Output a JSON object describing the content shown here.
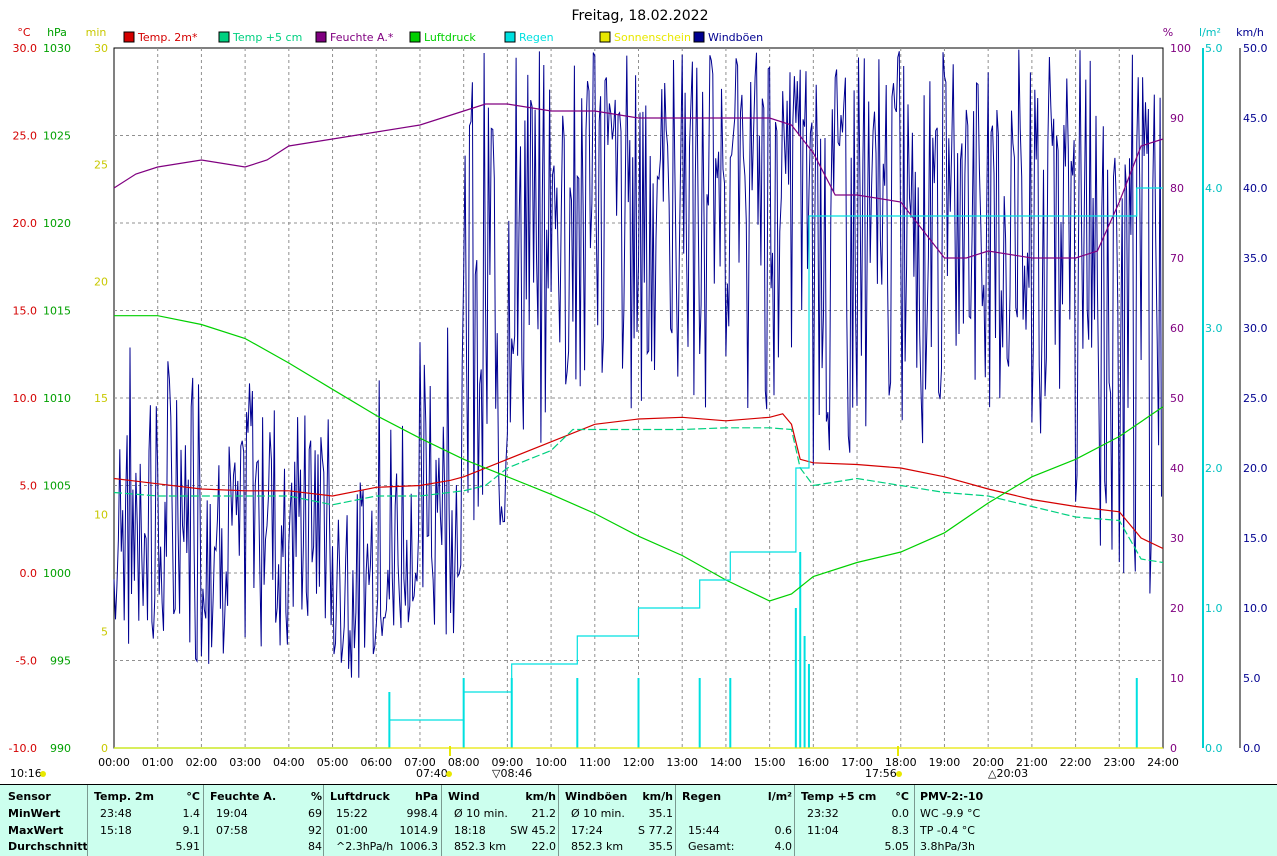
{
  "title": "Freitag, 18.02.2022",
  "colors": {
    "temp2m": "#d40000",
    "temp5cm": "#00d080",
    "feuchte": "#800080",
    "luftdruck": "#00d000",
    "regen": "#00e0e0",
    "sonne": "#e8e800",
    "wind": "#000090"
  },
  "axis_units": {
    "left1": "°C",
    "left2": "hPa",
    "left3": "min",
    "right1": "%",
    "right2": "l/m²",
    "right3": "km/h"
  },
  "ticks": {
    "temp": [
      "30.0",
      "25.0",
      "20.0",
      "15.0",
      "10.0",
      "5.0",
      "0.0",
      "-5.0",
      "-10.0"
    ],
    "hpa": [
      "1030",
      "1025",
      "1020",
      "1015",
      "1010",
      "1005",
      "1000",
      "995",
      "990"
    ],
    "min": [
      "30",
      "25",
      "20",
      "15",
      "10",
      "5",
      "0"
    ],
    "pct": [
      "100",
      "90",
      "80",
      "70",
      "60",
      "50",
      "40",
      "30",
      "20",
      "10",
      "0"
    ],
    "rain": [
      "5.0",
      "4.0",
      "3.0",
      "2.0",
      "1.0",
      "0.0"
    ],
    "kmh": [
      "50.0",
      "45.0",
      "40.0",
      "35.0",
      "30.0",
      "25.0",
      "20.0",
      "15.0",
      "10.0",
      "5.0",
      "0.0"
    ],
    "hours": [
      "00:00",
      "01:00",
      "02:00",
      "03:00",
      "04:00",
      "05:00",
      "06:00",
      "07:00",
      "08:00",
      "09:00",
      "10:00",
      "11:00",
      "12:00",
      "13:00",
      "14:00",
      "15:00",
      "16:00",
      "17:00",
      "18:00",
      "19:00",
      "20:00",
      "21:00",
      "22:00",
      "23:00",
      "24:00"
    ]
  },
  "time_marks": {
    "now": "10:16",
    "sunrise": "07:40",
    "dawn": "08:46",
    "sunset": "17:56",
    "dusk": "20:03"
  },
  "chart_data": {
    "type": "line",
    "title": "Freitag, 18.02.2022",
    "x_range_hours": [
      0,
      24
    ],
    "grid": true,
    "legend_position": "top",
    "axes": {
      "temp_c": [
        -10,
        30
      ],
      "pressure_hpa": [
        990,
        1030
      ],
      "sunshine_min": [
        0,
        30
      ],
      "humidity_pct": [
        0,
        100
      ],
      "rain_lm2": [
        0,
        5
      ],
      "wind_kmh": [
        0,
        50
      ]
    },
    "series": [
      {
        "name": "Temp. 2m*",
        "axis": "temp_c",
        "x": [
          0,
          1,
          2,
          3,
          4,
          5,
          6,
          7,
          7.7,
          8,
          9,
          10,
          11,
          12,
          13,
          14,
          15,
          15.3,
          15.5,
          15.7,
          16,
          17,
          18,
          19,
          20,
          21,
          22,
          23,
          23.5,
          24
        ],
        "y": [
          5.4,
          5.1,
          4.8,
          4.7,
          4.7,
          4.4,
          4.9,
          5.0,
          5.3,
          5.5,
          6.5,
          7.5,
          8.5,
          8.8,
          8.9,
          8.7,
          8.9,
          9.1,
          8.5,
          6.5,
          6.3,
          6.2,
          6.0,
          5.5,
          4.8,
          4.2,
          3.8,
          3.5,
          2.0,
          1.4
        ]
      },
      {
        "name": "Temp +5 cm",
        "axis": "temp_c",
        "x": [
          0,
          1,
          2,
          3,
          4,
          5,
          6,
          7,
          8,
          8.5,
          9,
          10,
          10.5,
          11,
          12,
          13,
          14,
          15,
          15.5,
          15.7,
          16,
          17,
          18,
          19,
          20,
          21,
          22,
          23,
          23.5,
          24
        ],
        "y": [
          4.6,
          4.4,
          4.4,
          4.4,
          4.4,
          3.9,
          4.4,
          4.4,
          4.7,
          5.0,
          6.0,
          7.0,
          8.2,
          8.2,
          8.2,
          8.2,
          8.3,
          8.3,
          8.2,
          6.0,
          5.0,
          5.4,
          5.0,
          4.6,
          4.4,
          3.8,
          3.2,
          3.0,
          0.8,
          0.6
        ]
      },
      {
        "name": "Feuchte A.*",
        "axis": "humidity_pct",
        "x": [
          0,
          0.5,
          1,
          2,
          3,
          3.5,
          4,
          5,
          6,
          7,
          8,
          8.5,
          9,
          10,
          11,
          12,
          13,
          14,
          15,
          15.5,
          16,
          16.5,
          17,
          18,
          19,
          19.5,
          20,
          21,
          22,
          22.5,
          23,
          23.5,
          24
        ],
        "y": [
          80,
          82,
          83,
          84,
          83,
          84,
          86,
          87,
          88,
          89,
          91,
          92,
          92,
          91,
          91,
          90,
          90,
          90,
          90,
          89,
          85,
          79,
          79,
          78,
          70,
          70,
          71,
          70,
          70,
          71,
          78,
          86,
          87
        ]
      },
      {
        "name": "Luftdruck",
        "axis": "pressure_hpa",
        "x": [
          0,
          1,
          2,
          3,
          4,
          5,
          6,
          7,
          8,
          9,
          10,
          11,
          12,
          13,
          14,
          15,
          15.5,
          16,
          17,
          18,
          19,
          20,
          21,
          22,
          23,
          24
        ],
        "y": [
          1014.7,
          1014.7,
          1014.2,
          1013.4,
          1012.0,
          1010.5,
          1009.0,
          1007.7,
          1006.5,
          1005.5,
          1004.5,
          1003.4,
          1002.1,
          1001.0,
          999.6,
          998.4,
          998.8,
          999.8,
          1000.6,
          1001.2,
          1002.3,
          1004.0,
          1005.5,
          1006.5,
          1007.8,
          1009.5
        ]
      },
      {
        "name": "Regen",
        "axis": "rain_lm2",
        "x": [
          0,
          6.3,
          6.3,
          8,
          8,
          9.1,
          9.1,
          10.6,
          10.6,
          12,
          12,
          13.4,
          13.4,
          14.1,
          14.1,
          15.6,
          15.6,
          15.9,
          15.9,
          23.4,
          23.4,
          24
        ],
        "y": [
          0,
          0,
          0.2,
          0.2,
          0.4,
          0.4,
          0.6,
          0.6,
          0.8,
          0.8,
          1.0,
          1.0,
          1.2,
          1.2,
          1.4,
          1.4,
          2.0,
          2.0,
          3.8,
          3.8,
          4.0,
          4.0
        ]
      },
      {
        "name": "Sonnenschein",
        "axis": "sunshine_min",
        "x": [
          0,
          24
        ],
        "y": [
          0,
          0
        ]
      },
      {
        "name": "Windböen",
        "axis": "wind_kmh",
        "hourly_avg": [
          16,
          16,
          17,
          19,
          17,
          12,
          14,
          17,
          27,
          35,
          40,
          42,
          41,
          42,
          42,
          43,
          41,
          40,
          43,
          42,
          41,
          40,
          38,
          34
        ],
        "hourly_min": [
          7,
          6,
          6,
          7,
          8,
          5,
          7,
          8,
          14,
          21,
          24,
          24,
          24,
          24,
          24,
          24,
          20,
          21,
          21,
          26,
          24,
          20,
          14,
          11
        ],
        "hourly_max": [
          29,
          28,
          22,
          28,
          24,
          19,
          27,
          32,
          50,
          50,
          50,
          50,
          50,
          50,
          50,
          50,
          50,
          50,
          50,
          50,
          50,
          50,
          50,
          50
        ]
      }
    ]
  },
  "legend": [
    {
      "label": "Temp. 2m*",
      "color": "#d40000"
    },
    {
      "label": "Temp +5 cm",
      "color": "#00d080"
    },
    {
      "label": "Feuchte A.*",
      "color": "#800080"
    },
    {
      "label": "Luftdruck",
      "color": "#00d000"
    },
    {
      "label": "Regen",
      "color": "#00e0e0"
    },
    {
      "label": "Sonnenschein",
      "color": "#e8e800"
    },
    {
      "label": "Windböen",
      "color": "#000090"
    }
  ],
  "stats": {
    "sensor": {
      "header": "Sensor",
      "row1": "MinWert",
      "row2": "MaxWert",
      "row3": "Durchschnitt"
    },
    "temp2m": {
      "header": "Temp. 2m",
      "unit": "°C",
      "r1t": "23:48",
      "r1v": "1.4",
      "r2t": "15:18",
      "r2v": "9.1",
      "r3t": "",
      "r3v": "5.91"
    },
    "feuchte": {
      "header": "Feuchte A.",
      "unit": "%",
      "r1t": "19:04",
      "r1v": "69",
      "r2t": "07:58",
      "r2v": "92",
      "r3t": "",
      "r3v": "84"
    },
    "luftdruck": {
      "header": "Luftdruck",
      "unit": "hPa",
      "r1t": "15:22",
      "r1v": "998.4",
      "r2t": "01:00",
      "r2v": "1014.9",
      "r3t": "^2.3hPa/h",
      "r3v": "1006.3"
    },
    "wind": {
      "header": "Wind",
      "unit": "km/h",
      "r1t": "Ø 10 min.",
      "r1v": "21.2",
      "r2t": "18:18",
      "r2v": "SW 45.2",
      "r3t": "852.3 km",
      "r3v": "22.0"
    },
    "boeen": {
      "header": "Windböen",
      "unit": "km/h",
      "r1t": "Ø 10 min.",
      "r1v": "35.1",
      "r2t": "17:24",
      "r2v": "S 77.2",
      "r3t": "852.3 km",
      "r3v": "35.5"
    },
    "regen": {
      "header": "Regen",
      "unit": "l/m²",
      "r1t": "",
      "r1v": "",
      "r2t": "15:44",
      "r2v": "0.6",
      "r3t": "Gesamt:",
      "r3v": "4.0"
    },
    "temp5": {
      "header": "Temp +5 cm",
      "unit": "°C",
      "r1t": "23:32",
      "r1v": "0.0",
      "r2t": "11:04",
      "r2v": "8.3",
      "r3t": "",
      "r3v": "5.05"
    },
    "pmv": {
      "header": "PMV-2:-10",
      "r1": "WC -9.9 °C",
      "r2": "TP -0.4 °C",
      "r3": "3.8hPa/3h"
    }
  }
}
